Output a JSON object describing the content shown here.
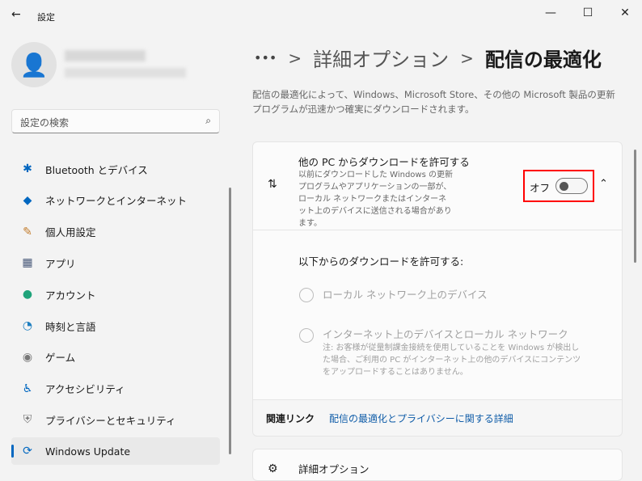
{
  "title": "設定",
  "window_controls": {
    "minimize": "—",
    "maximize": "☐",
    "close": "✕"
  },
  "search": {
    "placeholder": "設定の検索"
  },
  "sidebar": {
    "items": [
      {
        "label": "Bluetooth とデバイス",
        "icon": "bluetooth-icon",
        "glyph": "✱",
        "color": "#0067c0"
      },
      {
        "label": "ネットワークとインターネット",
        "icon": "wifi-icon",
        "glyph": "◆",
        "color": "#0067c0"
      },
      {
        "label": "個人用設定",
        "icon": "brush-icon",
        "glyph": "✎",
        "color": "#c27c2c"
      },
      {
        "label": "アプリ",
        "icon": "apps-icon",
        "glyph": "▦",
        "color": "#4a5a7a"
      },
      {
        "label": "アカウント",
        "icon": "account-icon",
        "glyph": "●",
        "color": "#1fa37a"
      },
      {
        "label": "時刻と言語",
        "icon": "clock-globe-icon",
        "glyph": "◔",
        "color": "#1f7fc0"
      },
      {
        "label": "ゲーム",
        "icon": "gamepad-icon",
        "glyph": "◉",
        "color": "#777"
      },
      {
        "label": "アクセシビリティ",
        "icon": "accessibility-icon",
        "glyph": "♿",
        "color": "#0067c0"
      },
      {
        "label": "プライバシーとセキュリティ",
        "icon": "shield-icon",
        "glyph": "⛨",
        "color": "#777"
      },
      {
        "label": "Windows Update",
        "icon": "windows-update-icon",
        "glyph": "⟳",
        "color": "#0067c0",
        "selected": true
      }
    ]
  },
  "breadcrumb": {
    "ellipsis": "•••",
    "sep": ">",
    "parent": "詳細オプション",
    "current": "配信の最適化"
  },
  "description": "配信の最適化によって、Windows、Microsoft Store、その他の Microsoft 製品の更新プログラムが迅速かつ確実にダウンロードされます。",
  "allow_card": {
    "title": "他の PC からダウンロードを許可する",
    "desc": "以前にダウンロードした Windows の更新プログラムやアプリケーションの一部が、ローカル ネットワークまたはインターネット上のデバイスに送信される場合があります。",
    "toggle_label": "オフ",
    "toggle_on": false
  },
  "allow_from": {
    "heading": "以下からのダウンロードを許可する:",
    "options": [
      {
        "label": "ローカル ネットワーク上のデバイス"
      },
      {
        "label": "インターネット上のデバイスとローカル ネットワーク",
        "note": "注: お客様が従量制課金接続を使用していることを Windows が検出した場合、ご利用の PC がインターネット上の他のデバイスにコンテンツをアップロードすることはありません。"
      }
    ]
  },
  "related": {
    "label": "関連リンク",
    "link": "配信の最適化とプライバシーに関する詳細"
  },
  "next_card": {
    "title": "詳細オプション"
  }
}
